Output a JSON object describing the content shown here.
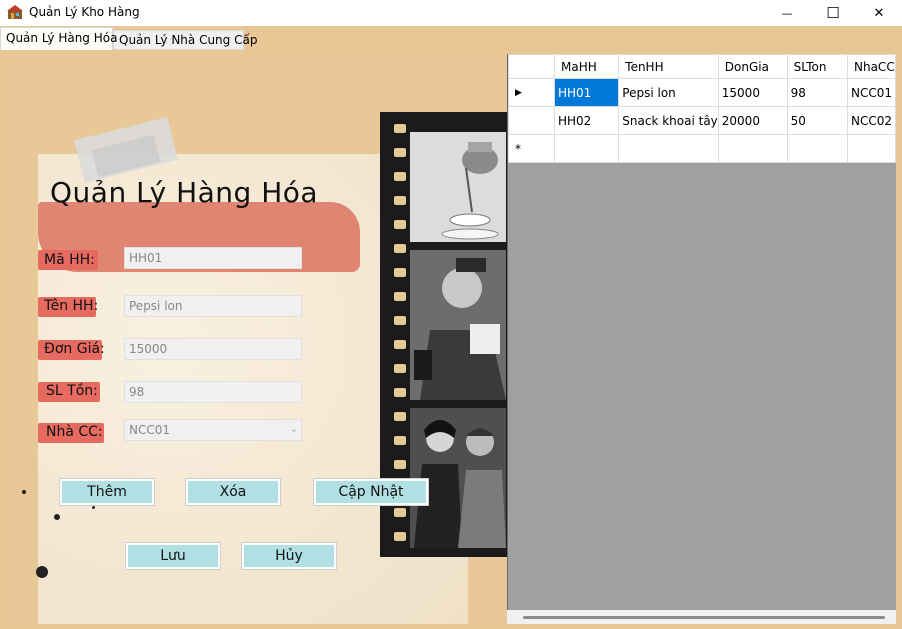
{
  "window": {
    "title": "Quản Lý Kho Hàng",
    "minimize_glyph": "—",
    "maximize_glyph": "☐",
    "close_glyph": "✕"
  },
  "tabs": [
    {
      "label": "Quản Lý Hàng Hóa",
      "active": true
    },
    {
      "label": "Quản Lý Nhà Cung Cấp",
      "active": false
    }
  ],
  "form": {
    "heading": "Quản Lý Hàng Hóa",
    "fields": [
      {
        "label": "Mã HH:",
        "value": "HH01"
      },
      {
        "label": "Tên HH:",
        "value": "Pepsi lon"
      },
      {
        "label": "Đơn Giá:",
        "value": "15000"
      },
      {
        "label": "SL Tồn:",
        "value": "98"
      },
      {
        "label": "Nhà CC:",
        "value": "NCC01"
      }
    ],
    "combo_arrow": "⌄",
    "buttons": {
      "add": "Thêm",
      "delete": "Xóa",
      "update": "Cập Nhật",
      "save": "Lưu",
      "cancel": "Hủy"
    }
  },
  "grid": {
    "columns": [
      "MaHH",
      "TenHH",
      "DonGia",
      "SLTon",
      "NhaCC"
    ],
    "rows": [
      {
        "indicator": "▶",
        "cells": [
          "HH01",
          "Pepsi lon",
          "15000",
          "98",
          "NCC01"
        ]
      },
      {
        "indicator": "",
        "cells": [
          "HH02",
          "Snack khoai tây",
          "20000",
          "50",
          "NCC02"
        ]
      },
      {
        "indicator": "*",
        "cells": [
          "",
          "",
          "",
          "",
          ""
        ]
      }
    ]
  },
  "colors": {
    "background": "#e9c795",
    "button": "#b1e0e4",
    "label_highlight": "#e66a5f",
    "selection": "#0078d7",
    "grid_empty": "#a0a0a0"
  }
}
